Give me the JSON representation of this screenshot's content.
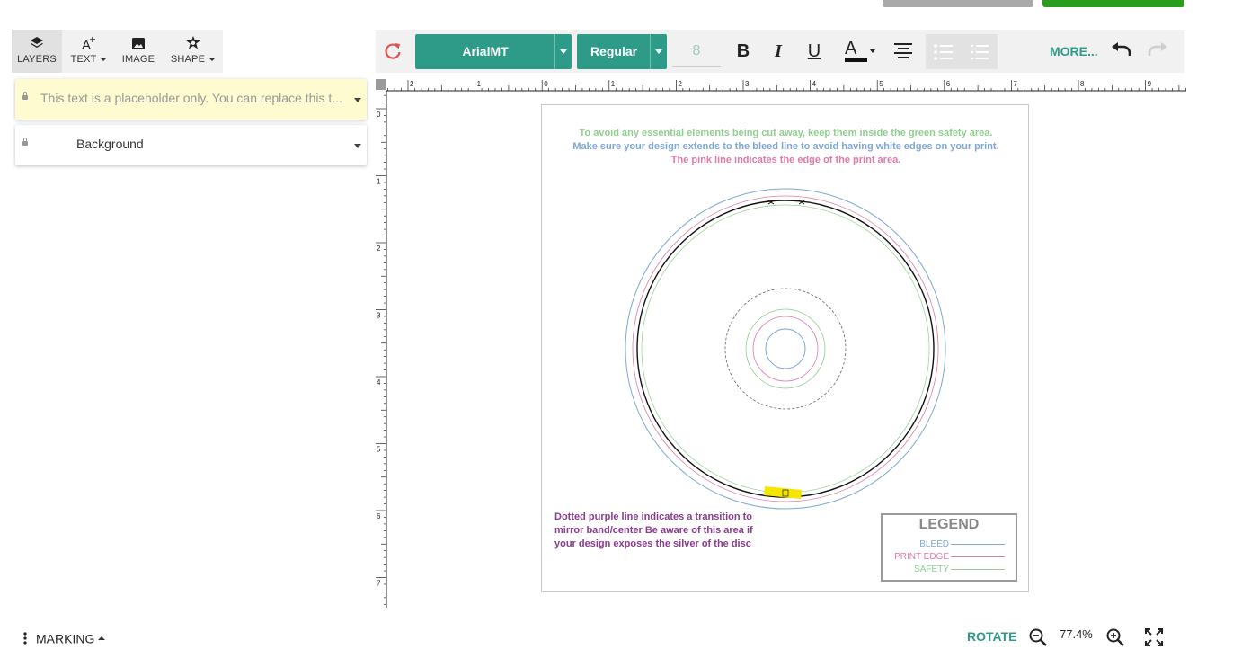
{
  "toolbar_left": {
    "layers": "LAYERS",
    "text": "TEXT",
    "image": "IMAGE",
    "shape": "SHAPE"
  },
  "toolbar_right": {
    "font_family": "ArialMT",
    "font_style": "Regular",
    "font_size": "8",
    "more": "MORE..."
  },
  "layers": [
    {
      "label": "This text is a placeholder only. You can replace this t..."
    },
    {
      "label": "Background"
    }
  ],
  "ruler": {
    "h_labels": [
      "2",
      "1",
      "0",
      "1",
      "2",
      "3",
      "4",
      "5",
      "6",
      "7",
      "8",
      "9"
    ],
    "v_labels": [
      "0",
      "1",
      "2",
      "3",
      "4",
      "5",
      "6",
      "7"
    ]
  },
  "template": {
    "line1": "To avoid any essential elements being cut away, keep them inside the green safety area.",
    "line2": "Make sure your design extends to the bleed line to avoid having white edges on your print.",
    "line3": "The pink line indicates the edge of the print area.",
    "note_line1": "Dotted purple line indicates a transition to",
    "note_line2": "mirror band/center Be aware of this area if",
    "note_line3": "your design exposes the silver of the disc",
    "legend_title": "LEGEND",
    "legend_bleed": "BLEED",
    "legend_print_edge": "PRINT EDGE",
    "legend_safety": "SAFETY",
    "colors": {
      "safety": "#8fcf8f",
      "bleed": "#7fa7d6",
      "print_edge": "#e07aa8",
      "note": "#8a3c8f"
    }
  },
  "bottom": {
    "marking": "MARKING",
    "rotate": "ROTATE",
    "zoom": "77.4%"
  },
  "colors": {
    "accent": "#2e9b88",
    "primary_button": "#2a9d1f",
    "secondary_button": "#a9a9a9",
    "selected_layer_bg": "#fdfbcf"
  }
}
